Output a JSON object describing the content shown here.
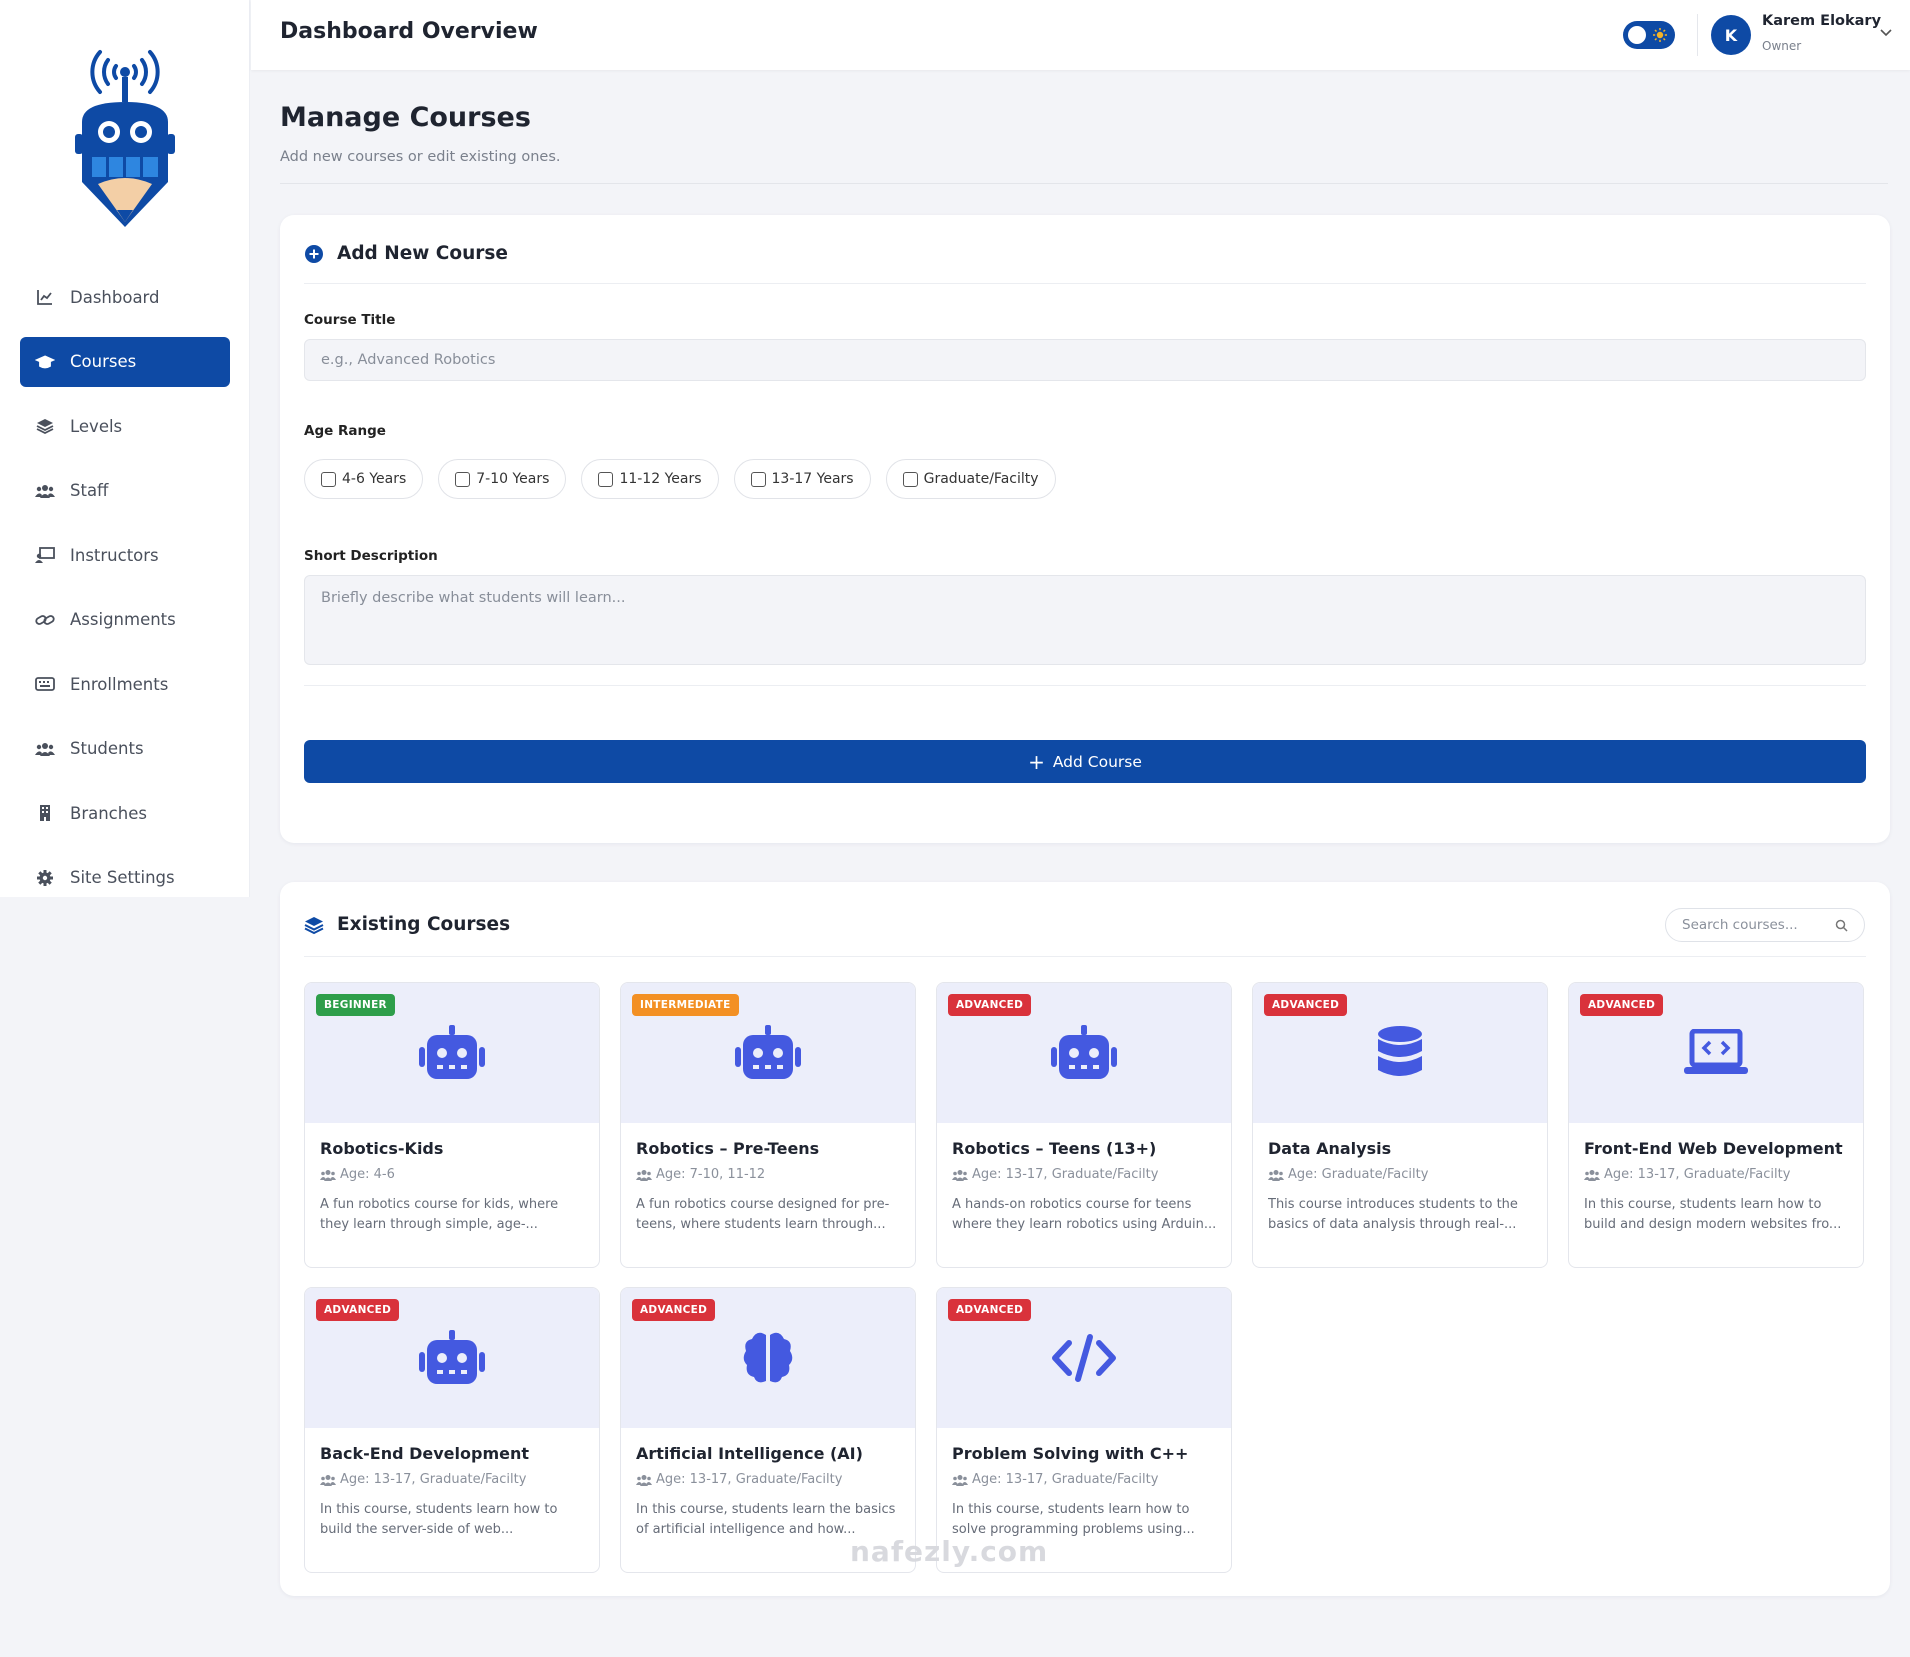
{
  "header": {
    "title": "Dashboard Overview",
    "user_initial": "K",
    "user_name": "Karem Elokary",
    "user_role": "Owner"
  },
  "sidebar": {
    "items": [
      {
        "label": "Dashboard",
        "icon": "chart-line-icon"
      },
      {
        "label": "Courses",
        "icon": "graduation-cap-icon",
        "active": true
      },
      {
        "label": "Levels",
        "icon": "layers-icon"
      },
      {
        "label": "Staff",
        "icon": "users-icon"
      },
      {
        "label": "Instructors",
        "icon": "chalkboard-teacher-icon"
      },
      {
        "label": "Assignments",
        "icon": "link-icon"
      },
      {
        "label": "Enrollments",
        "icon": "keyboard-icon"
      },
      {
        "label": "Students",
        "icon": "users-icon"
      },
      {
        "label": "Branches",
        "icon": "building-icon"
      },
      {
        "label": "Site Settings",
        "icon": "gear-icon"
      }
    ]
  },
  "page": {
    "title": "Manage Courses",
    "subtitle": "Add new courses or edit existing ones."
  },
  "add_form": {
    "heading": "Add New Course",
    "title_label": "Course Title",
    "title_placeholder": "e.g., Advanced Robotics",
    "age_label": "Age Range",
    "age_options": [
      "4-6 Years",
      "7-10 Years",
      "11-12 Years",
      "13-17 Years",
      "Graduate/Facilty"
    ],
    "desc_label": "Short Description",
    "desc_placeholder": "Briefly describe what students will learn...",
    "submit_label": "Add Course"
  },
  "courses_section": {
    "heading": "Existing Courses",
    "search_placeholder": "Search courses..."
  },
  "courses": [
    {
      "level": "BEGINNER",
      "level_class": "beginner",
      "icon": "robot-icon",
      "name": "Robotics-Kids",
      "age": "Age: 4-6",
      "desc": "A fun robotics course for kids, where they learn through simple, age-..."
    },
    {
      "level": "INTERMEDIATE",
      "level_class": "intermediate",
      "icon": "robot-icon",
      "name": "Robotics – Pre-Teens",
      "age": "Age: 7-10, 11-12",
      "desc": "A fun robotics course designed for pre-teens, where students learn through..."
    },
    {
      "level": "ADVANCED",
      "level_class": "advanced",
      "icon": "robot-icon",
      "name": "Robotics – Teens (13+)",
      "age": "Age: 13-17, Graduate/Facilty",
      "desc": "A hands-on robotics course for teens where they learn robotics using Arduin..."
    },
    {
      "level": "ADVANCED",
      "level_class": "advanced",
      "icon": "database-icon",
      "name": "Data Analysis",
      "age": "Age: Graduate/Facilty",
      "desc": "This course introduces students to the basics of data analysis through real-..."
    },
    {
      "level": "ADVANCED",
      "level_class": "advanced",
      "icon": "laptop-code-icon",
      "name": "Front-End Web Development",
      "age": "Age: 13-17, Graduate/Facilty",
      "desc": "In this course, students learn how to build and design modern websites fro..."
    },
    {
      "level": "ADVANCED",
      "level_class": "advanced",
      "icon": "robot-icon",
      "name": "Back-End Development",
      "age": "Age: 13-17, Graduate/Facilty",
      "desc": "In this course, students learn how to build the server-side of web..."
    },
    {
      "level": "ADVANCED",
      "level_class": "advanced",
      "icon": "brain-icon",
      "name": "Artificial Intelligence (AI)",
      "age": "Age: 13-17, Graduate/Facilty",
      "desc": "In this course, students learn the basics of artificial intelligence and how..."
    },
    {
      "level": "ADVANCED",
      "level_class": "advanced",
      "icon": "code-icon",
      "name": "Problem Solving with C++",
      "age": "Age: 13-17, Graduate/Facilty",
      "desc": "In this course, students learn how to solve programming problems using..."
    }
  ],
  "watermark": "nafezly.com",
  "colors": {
    "primary": "#0e4aa5",
    "icon_blue": "#4459e0",
    "beginner": "#2e9e4a",
    "intermediate": "#f39024",
    "advanced": "#d9323b"
  }
}
